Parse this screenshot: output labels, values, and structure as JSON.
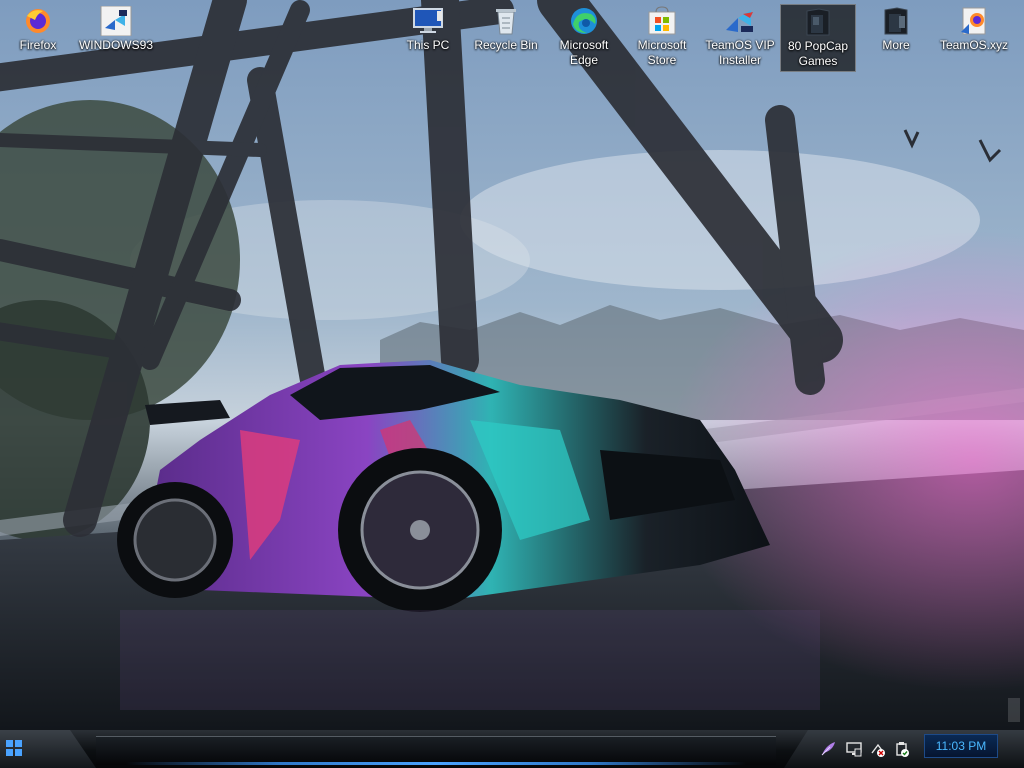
{
  "desktop": {
    "icons": [
      {
        "label": "Firefox",
        "icon": "firefox-icon"
      },
      {
        "label": "WINDOWS93",
        "icon": "windows93-icon"
      },
      {
        "label": "This PC",
        "icon": "this-pc-icon"
      },
      {
        "label": "Recycle Bin",
        "icon": "recycle-bin-icon"
      },
      {
        "label": "Microsoft Edge",
        "icon": "edge-icon"
      },
      {
        "label": "Microsoft Store",
        "icon": "store-icon"
      },
      {
        "label": "TeamOS VIP Installer",
        "icon": "teamos-installer-icon"
      },
      {
        "label": "80 PopCap Games",
        "icon": "popcap-folder-icon",
        "selected": true
      },
      {
        "label": "More",
        "icon": "more-folder-icon"
      },
      {
        "label": "TeamOS.xyz",
        "icon": "teamos-xyz-icon"
      }
    ]
  },
  "taskbar": {
    "clock": "11:03 PM",
    "tray_icons": [
      "feather-icon",
      "monitor-icon",
      "network-icon",
      "volume-icon"
    ]
  },
  "colors": {
    "accent": "#4ab8ff",
    "selection": "#1e1e1e"
  }
}
